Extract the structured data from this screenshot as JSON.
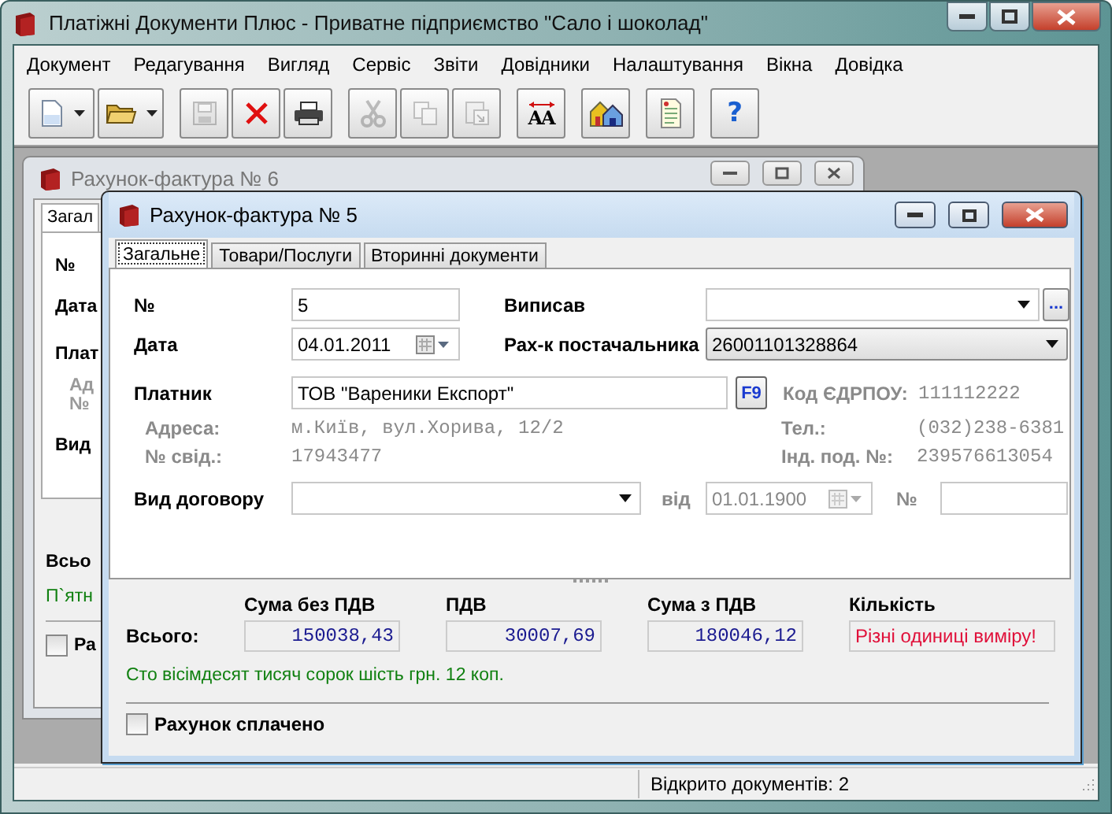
{
  "window": {
    "title": "Платіжні Документи Плюс - Приватне підприємство \"Сало і шоколад\""
  },
  "menu": [
    "Документ",
    "Редагування",
    "Вигляд",
    "Сервіс",
    "Звіти",
    "Довідники",
    "Налаштування",
    "Вікна",
    "Довідка"
  ],
  "toolbar_groups": [
    [
      {
        "kind": "new",
        "dropdown": true,
        "disabled": false
      },
      {
        "kind": "open",
        "dropdown": true,
        "disabled": false
      }
    ],
    [
      {
        "kind": "save",
        "dropdown": false,
        "disabled": true
      },
      {
        "kind": "delete",
        "dropdown": false,
        "disabled": false
      },
      {
        "kind": "print",
        "dropdown": false,
        "disabled": false
      }
    ],
    [
      {
        "kind": "cut",
        "dropdown": false,
        "disabled": true
      },
      {
        "kind": "copy",
        "dropdown": false,
        "disabled": true
      },
      {
        "kind": "paste",
        "dropdown": false,
        "disabled": true
      }
    ],
    [
      {
        "kind": "font",
        "glyph": "AA",
        "dropdown": false,
        "disabled": false
      }
    ],
    [
      {
        "kind": "home",
        "dropdown": false,
        "disabled": false
      }
    ],
    [
      {
        "kind": "report",
        "dropdown": false,
        "disabled": false
      }
    ],
    [
      {
        "kind": "help",
        "glyph": "?",
        "dropdown": false,
        "disabled": false
      }
    ]
  ],
  "back_document": {
    "title": "Рахунок-фактура № 6",
    "tab": "Загал",
    "labels": [
      "№",
      "Дата",
      "Плат"
    ],
    "sub_labels": [
      "Ад",
      "№"
    ],
    "contract_label": "Вид",
    "total_label": "Всьо",
    "amount_words": "П`ятн",
    "paid_label": "Ра",
    "paid_checked": false
  },
  "document": {
    "title": "Рахунок-фактура № 5",
    "tabs": [
      {
        "label": "Загальне",
        "selected": true
      },
      {
        "label": "Товари/Послуги",
        "selected": false
      },
      {
        "label": "Вторинні документи",
        "selected": false
      }
    ],
    "number": {
      "label": "№",
      "value": "5"
    },
    "date": {
      "label": "Дата",
      "value": "04.01.2011"
    },
    "issued_by": {
      "label": "Виписав",
      "button": "..."
    },
    "supplier_account": {
      "label": "Рах-к постачальника",
      "value": "26001101328864"
    },
    "payer": {
      "label": "Платник",
      "value": "ТОВ \"Вареники Експорт\"",
      "button": "F9"
    },
    "payer_details": [
      {
        "label": "Адреса:",
        "value": "м.Київ, вул.Хорива, 12/2"
      },
      {
        "label": "№ свід.:",
        "value": "17943477"
      }
    ],
    "payer_codes": [
      {
        "label": "Код ЄДРПОУ:",
        "value": "111112222"
      },
      {
        "label": "Тел.:",
        "value": "(032)238-6381"
      },
      {
        "label": "Інд. под. №:",
        "value": "239576613054"
      }
    ],
    "contract": {
      "label": "Вид договору",
      "date_label": "від",
      "date": "01.01.1900",
      "date_disabled": true,
      "number_label": "№"
    },
    "totals": {
      "label": "Всього:",
      "columns": [
        {
          "heading": "Сума без ПДВ",
          "value": "150038,43",
          "kind": "amount"
        },
        {
          "heading": "ПДВ",
          "value": "30007,69",
          "kind": "amount"
        },
        {
          "heading": "Сума з ПДВ",
          "value": "180046,12",
          "kind": "amount"
        },
        {
          "heading": "Кількість",
          "value": "Різні одиниці виміру!",
          "kind": "warning"
        }
      ]
    },
    "amount_in_words": "Сто вісімдесят тисяч сорок шість грн. 12 коп.",
    "paid": {
      "label": "Рахунок сплачено",
      "checked": false
    }
  },
  "status_bar": {
    "text": "Відкрито документів: 2"
  }
}
